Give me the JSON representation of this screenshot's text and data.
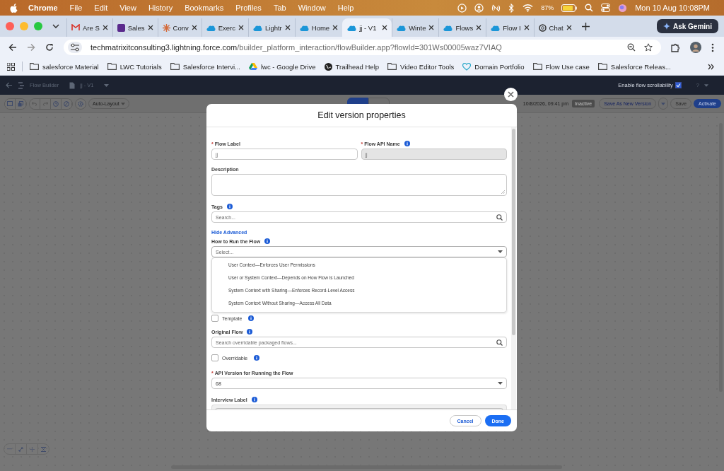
{
  "menubar": {
    "app": "Chrome",
    "items": [
      "File",
      "Edit",
      "View",
      "History",
      "Bookmarks",
      "Profiles",
      "Tab",
      "Window",
      "Help"
    ],
    "battery": "87%",
    "clock": "Mon 10 Aug  10:08PM"
  },
  "tabs": [
    {
      "label": "Are S",
      "kind": "mail",
      "selected": false
    },
    {
      "label": "Sales",
      "kind": "square",
      "selected": false
    },
    {
      "label": "Conv",
      "kind": "spark",
      "selected": false
    },
    {
      "label": "Exerc",
      "kind": "cloud",
      "selected": false
    },
    {
      "label": "Lightr",
      "kind": "cloud",
      "selected": false
    },
    {
      "label": "Home",
      "kind": "cloud",
      "selected": false
    },
    {
      "label": "jj - V1",
      "kind": "cloud",
      "selected": true
    },
    {
      "label": "Winte",
      "kind": "cloud",
      "selected": false
    },
    {
      "label": "Flows",
      "kind": "cloud",
      "selected": false
    },
    {
      "label": "Flow I",
      "kind": "cloud",
      "selected": false
    },
    {
      "label": "Chat",
      "kind": "knot",
      "selected": false
    }
  ],
  "gemini": "Ask Gemini",
  "address": {
    "host": "techmatrixitconsulting3.lightning.force.com",
    "path": "/builder_platform_interaction/flowBuilder.app?flowId=301Ws00005waz7VIAQ"
  },
  "bookmarks": [
    {
      "label": "salesforce Material",
      "kind": "folder"
    },
    {
      "label": "LWC Tutorials",
      "kind": "folder"
    },
    {
      "label": "Salesforce Intervi...",
      "kind": "folder"
    },
    {
      "label": "lwc - Google Drive",
      "kind": "drive"
    },
    {
      "label": "Trailhead Help",
      "kind": "globe"
    },
    {
      "label": "Video Editor Tools",
      "kind": "folder"
    },
    {
      "label": "Domain Portfolio",
      "kind": "heart"
    },
    {
      "label": "Flow Use case",
      "kind": "folder"
    },
    {
      "label": "Salesforce Releas...",
      "kind": "folder"
    }
  ],
  "app_header": {
    "title": "Flow Builder",
    "flow": "jj - V1",
    "scroll_label": "Enable flow scrollability",
    "scroll_checked": true,
    "help": "?"
  },
  "toolbar": {
    "layout": "Auto-Layout",
    "modes": [
      {
        "selected": true
      },
      {
        "selected": false
      }
    ],
    "last_saved": "10/8/2026, 09:41 pm",
    "status": "Inactive",
    "save_as": "Save As New Version",
    "save": "Save",
    "activate": "Activate"
  },
  "modal": {
    "title": "Edit version properties",
    "name_fields": [
      {
        "label": "Flow Label",
        "required": "*",
        "value": "jj",
        "disabled": false
      },
      {
        "label": "Flow API Name",
        "required": "*",
        "info": true,
        "value": "jj",
        "disabled": true
      }
    ],
    "fields": [
      {
        "kind": "textarea",
        "label": "Description"
      },
      {
        "kind": "search",
        "label": "Tags",
        "info": true,
        "placeholder": "Search..."
      },
      {
        "kind": "link",
        "label": "Hide Advanced"
      },
      {
        "kind": "select",
        "label": "How to Run the Flow",
        "info": true,
        "placeholder": "Select...",
        "open": true,
        "options": [
          "User Context—Enforces User Permissions",
          "User or System Context—Depends on How Flow is Launched",
          "System Context with Sharing—Enforces Record-Level Access",
          "System Context Without Sharing—Access All Data"
        ]
      },
      {
        "kind": "checkbox",
        "label": "Template",
        "info": true,
        "checked": false
      },
      {
        "kind": "search",
        "label": "Original Flow",
        "info": true,
        "placeholder": "Search overridable packaged flows..."
      },
      {
        "kind": "checkbox",
        "label": "Overridable",
        "info": true,
        "checked": false
      },
      {
        "kind": "select",
        "label": "API Version for Running the Flow",
        "required": "*",
        "value": "68",
        "open": false
      },
      {
        "kind": "cut",
        "label": "Interview Label",
        "info": true
      }
    ],
    "cancel": "Cancel",
    "done": "Done"
  }
}
